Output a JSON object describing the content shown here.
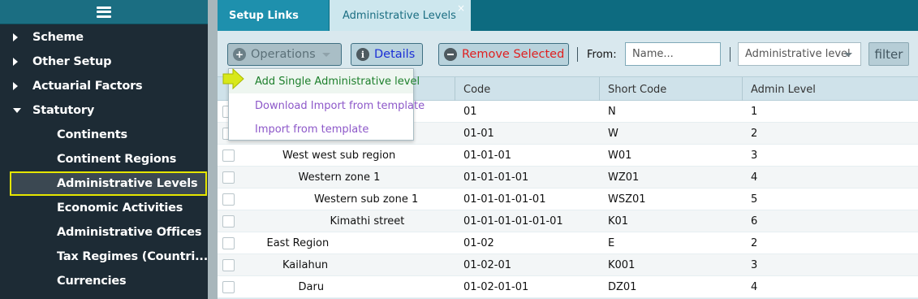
{
  "sidebar": {
    "toggle_icon": "hamburger-icon",
    "items": [
      {
        "label": "Scheme",
        "type": "collapsed"
      },
      {
        "label": "Other Setup",
        "type": "collapsed"
      },
      {
        "label": "Actuarial Factors",
        "type": "collapsed"
      },
      {
        "label": "Statutory",
        "type": "expanded"
      }
    ],
    "sub_items": [
      {
        "label": "Continents"
      },
      {
        "label": "Continent Regions"
      },
      {
        "label": "Administrative Levels",
        "active": true
      },
      {
        "label": "Economic Activities"
      },
      {
        "label": "Administrative Offices"
      },
      {
        "label": "Tax Regimes (Countri..."
      },
      {
        "label": "Currencies"
      }
    ]
  },
  "tabs": [
    {
      "label": "Setup Links"
    },
    {
      "label": "Administrative Levels",
      "close": "×"
    }
  ],
  "toolbar": {
    "operations_label": "Operations",
    "details_label": "Details",
    "remove_label": "Remove Selected",
    "from_label": "From:",
    "name_placeholder": "Name...",
    "level_select_value": "Administrative level",
    "filter_label": "filter",
    "ops_icon": "plus-icon",
    "details_icon": "info-icon",
    "remove_icon": "minus-icon"
  },
  "operations_menu": {
    "items": [
      "Add Single Administrative level",
      "Download Import from template",
      "Import from template"
    ]
  },
  "table": {
    "columns": [
      "",
      "Code",
      "Short Code",
      "Admin Level"
    ],
    "rows": [
      {
        "name": "",
        "code": "01",
        "short": "N",
        "level": "1",
        "indent": 0
      },
      {
        "name": "",
        "code": "01-01",
        "short": "W",
        "level": "2",
        "indent": 0
      },
      {
        "name": "West west sub region",
        "code": "01-01-01",
        "short": "W01",
        "level": "3",
        "indent": 2
      },
      {
        "name": "Western zone 1",
        "code": "01-01-01-01",
        "short": "WZ01",
        "level": "4",
        "indent": 3
      },
      {
        "name": "Western sub zone 1",
        "code": "01-01-01-01-01",
        "short": "WSZ01",
        "level": "5",
        "indent": 4
      },
      {
        "name": "Kimathi street",
        "code": "01-01-01-01-01-01",
        "short": "K01",
        "level": "6",
        "indent": 5
      },
      {
        "name": "East Region",
        "code": "01-02",
        "short": "E",
        "level": "2",
        "indent": 1
      },
      {
        "name": "Kailahun",
        "code": "01-02-01",
        "short": "K001",
        "level": "3",
        "indent": 2
      },
      {
        "name": "Daru",
        "code": "01-02-01-01",
        "short": "DZ01",
        "level": "4",
        "indent": 3
      }
    ]
  },
  "colors": {
    "sidebar_bg": "#1d2b35",
    "tab_bar": "#0d6b80",
    "active_highlight": "#e6e600",
    "remove_text": "#e02020",
    "details_text": "#1c2fd6",
    "menu_first_item": "#1c7f2b",
    "menu_items": "#8d58c9"
  }
}
